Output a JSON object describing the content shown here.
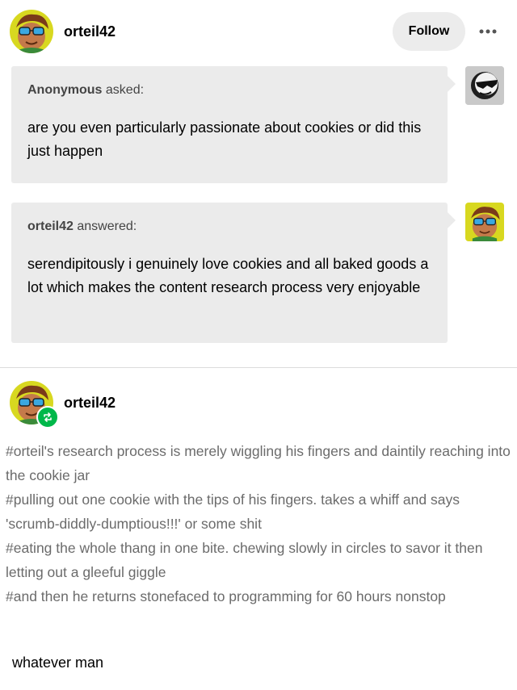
{
  "post_header": {
    "username": "orteil42",
    "follow_label": "Follow",
    "more_icon": "more-options-icon"
  },
  "ask": {
    "asker_name": "Anonymous",
    "asker_verb": "asked:",
    "question": "are you even particularly passionate about cookies or did this just happen",
    "asker_avatar_icon": "anonymous-sunglasses-avatar-icon"
  },
  "answer": {
    "answerer_name": "orteil42",
    "answerer_verb": "answered:",
    "text": "serendipitously i genuinely love cookies and all baked goods a lot which makes the content research process very enjoyable"
  },
  "reblog": {
    "username": "orteil42",
    "badge_icon": "reblog-icon",
    "tags": [
      "#orteil's research process is merely wiggling his fingers and daintily reaching into the cookie jar",
      "#pulling out one cookie with the tips of his fingers. takes a whiff and says 'scrumb-diddly-dumptious!!!' or some shit",
      "#eating the whole thang in one bite. chewing slowly in circles to savor it then letting out a gleeful giggle",
      "#and then he returns stonefaced to programming for 60 hours nonstop"
    ],
    "comment": "whatever man"
  },
  "colors": {
    "bubble_bg": "#ebebeb",
    "follow_bg": "#ececec",
    "reblog_green": "#00b84a",
    "tag_gray": "#6b6b6b"
  }
}
